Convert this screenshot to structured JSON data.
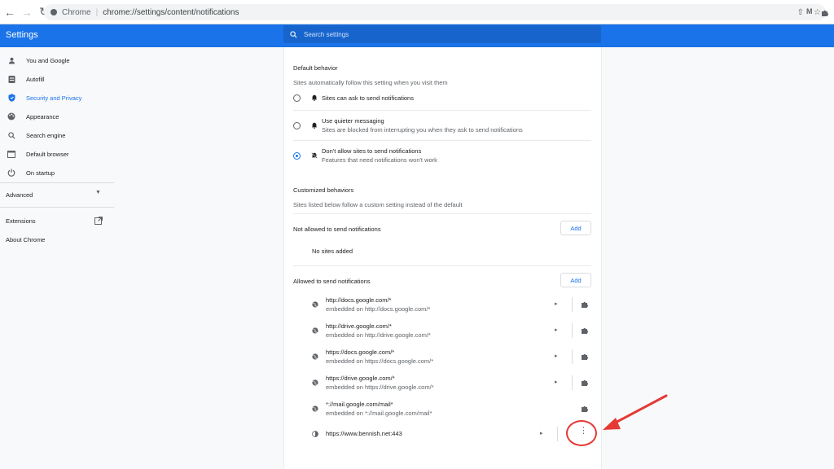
{
  "browser": {
    "site_name": "Chrome",
    "url": "chrome://settings/content/notifications"
  },
  "header": {
    "title": "Settings",
    "search_placeholder": "Search settings"
  },
  "sidebar": {
    "items": [
      {
        "label": "You and Google",
        "icon": "person-icon"
      },
      {
        "label": "Autofill",
        "icon": "clipboard-icon"
      },
      {
        "label": "Security and Privacy",
        "icon": "shield-icon",
        "active": true
      },
      {
        "label": "Appearance",
        "icon": "palette-icon"
      },
      {
        "label": "Search engine",
        "icon": "search-icon"
      },
      {
        "label": "Default browser",
        "icon": "browser-icon"
      },
      {
        "label": "On startup",
        "icon": "power-icon"
      }
    ],
    "advanced_label": "Advanced",
    "extensions_label": "Extensions",
    "about_label": "About Chrome"
  },
  "content": {
    "default_behavior": {
      "heading": "Default behavior",
      "subtitle": "Sites automatically follow this setting when you visit them",
      "options": [
        {
          "label": "Sites can ask to send notifications",
          "desc": ""
        },
        {
          "label": "Use quieter messaging",
          "desc": "Sites are blocked from interrupting you when they ask to send notifications"
        },
        {
          "label": "Don't allow sites to send notifications",
          "desc": "Features that need notifications won't work"
        }
      ]
    },
    "customized": {
      "heading": "Customized behaviors",
      "subtitle": "Sites listed below follow a custom setting instead of the default",
      "not_allowed_label": "Not allowed to send notifications",
      "add_label": "Add",
      "no_sites": "No sites added",
      "allowed_label": "Allowed to send notifications",
      "sites": [
        {
          "url": "http://docs.google.com/*",
          "embedded": "embedded on http://docs.google.com/*"
        },
        {
          "url": "http://drive.google.com/*",
          "embedded": "embedded on http://drive.google.com/*"
        },
        {
          "url": "https://docs.google.com/*",
          "embedded": "embedded on https://docs.google.com/*"
        },
        {
          "url": "https://drive.google.com/*",
          "embedded": "embedded on https://drive.google.com/*"
        },
        {
          "url": "*://mail.google.com/mail*",
          "embedded": "embedded on *://mail.google.com/mail*"
        },
        {
          "url": "https://www.bennish.net:443",
          "embedded": ""
        }
      ]
    }
  },
  "colors": {
    "accent": "#1a73e8",
    "annotation": "#e53935"
  }
}
